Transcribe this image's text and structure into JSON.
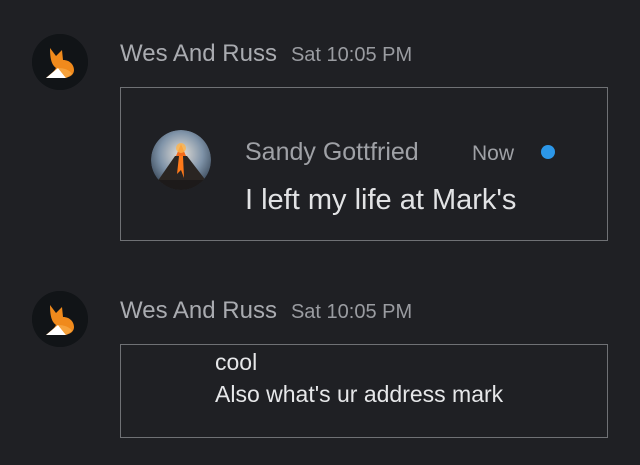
{
  "messages": [
    {
      "sender": "Wes And Russ",
      "time": "Sat 10:05 PM",
      "avatar_icon": "fox-logo-icon"
    },
    {
      "sender": "Wes And Russ",
      "time": "Sat 10:05 PM",
      "avatar_icon": "fox-logo-icon"
    }
  ],
  "quoted": {
    "name": "Sandy Gottfried",
    "time": "Now",
    "text": "I left my life at Mark's",
    "avatar_icon": "volcano-avatar-icon",
    "unread_color": "#2c97e8"
  },
  "reply_lines": [
    "cool",
    "Also what's ur address mark"
  ],
  "colors": {
    "background": "#1f2024",
    "fox_orange": "#f08a1c",
    "box_border": "#6f7175"
  }
}
